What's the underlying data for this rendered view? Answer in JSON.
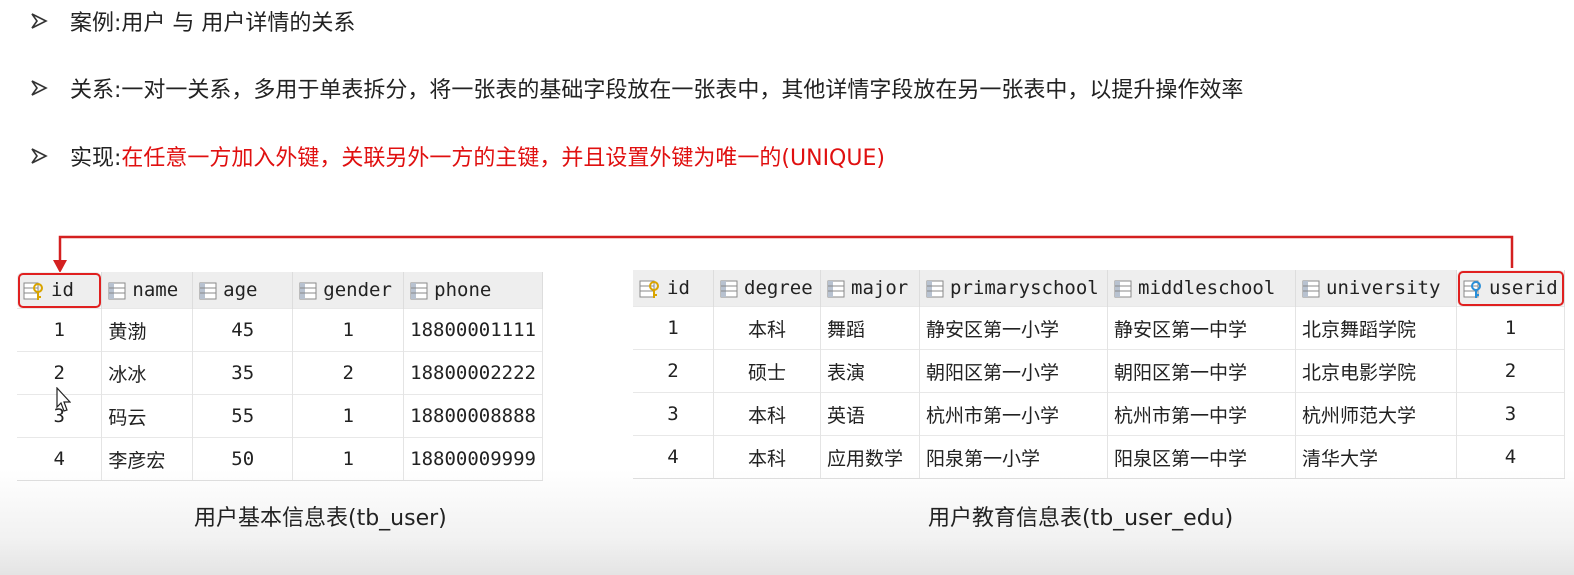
{
  "bullets": [
    {
      "label": "案例: ",
      "text": "用户 与 用户详情的关系",
      "highlight": ""
    },
    {
      "label": "关系: ",
      "text": "一对一关系，多用于单表拆分，将一张表的基础字段放在一张表中，其他详情字段放在另一张表中，以提升操作效率",
      "highlight": ""
    },
    {
      "label": "实现: ",
      "text": "",
      "highlight": "在任意一方加入外键，关联另外一方的主键，并且设置外键为唯一的(UNIQUE)"
    }
  ],
  "highlight_color": "#e01010",
  "tb_user": {
    "caption": "用户基本信息表(tb_user)",
    "columns": [
      "id",
      "name",
      "age",
      "gender",
      "phone"
    ],
    "rows": [
      [
        "1",
        "黄渤",
        "45",
        "1",
        "18800001111"
      ],
      [
        "2",
        "冰冰",
        "35",
        "2",
        "18800002222"
      ],
      [
        "3",
        "码云",
        "55",
        "1",
        "18800008888"
      ],
      [
        "4",
        "李彦宏",
        "50",
        "1",
        "18800009999"
      ]
    ]
  },
  "tb_user_edu": {
    "caption": "用户教育信息表(tb_user_edu)",
    "columns": [
      "id",
      "degree",
      "major",
      "primaryschool",
      "middleschool",
      "university",
      "userid"
    ],
    "rows": [
      [
        "1",
        "本科",
        "舞蹈",
        "静安区第一小学",
        "静安区第一中学",
        "北京舞蹈学院",
        "1"
      ],
      [
        "2",
        "硕士",
        "表演",
        "朝阳区第一小学",
        "朝阳区第一中学",
        "北京电影学院",
        "2"
      ],
      [
        "3",
        "本科",
        "英语",
        "杭州市第一小学",
        "杭州市第一中学",
        "杭州师范大学",
        "3"
      ],
      [
        "4",
        "本科",
        "应用数学",
        "阳泉第一小学",
        "阳泉区第一中学",
        "清华大学",
        "4"
      ]
    ]
  },
  "icons": {
    "primary_key": "key-column-icon",
    "column": "column-icon",
    "foreign_key": "foreign-key-column-icon",
    "cursor": "mouse-cursor-icon"
  }
}
